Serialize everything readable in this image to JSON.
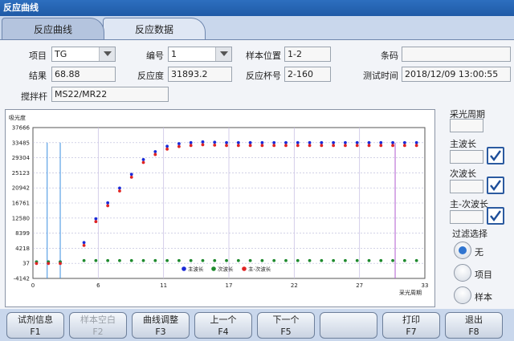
{
  "window": {
    "title": "反应曲线"
  },
  "tabs": [
    {
      "label": "反应曲线",
      "active": true
    },
    {
      "label": "反应数据",
      "active": false
    }
  ],
  "form": {
    "item_label": "项目",
    "item_value": "TG",
    "number_label": "编号",
    "number_value": "1",
    "sample_pos_label": "样本位置",
    "sample_pos_value": "1-2",
    "barcode_label": "条码",
    "barcode_value": "",
    "result_label": "结果",
    "result_value": "68.88",
    "absorbance_label": "反应度",
    "absorbance_value": "31893.2",
    "cup_label": "反应杯号",
    "cup_value": "2-160",
    "test_time_label": "测试时间",
    "test_time_value": "2018/12/09 13:00:55",
    "stirrer_label": "搅拌杆",
    "stirrer_value": "MS22/MR22"
  },
  "chart_data": {
    "type": "scatter",
    "ylabel": "吸光度",
    "xlabel": "采光周期",
    "xlim": [
      0,
      33
    ],
    "ylim": [
      -4142,
      37666
    ],
    "y_ticks": [
      "37666",
      "33485",
      "29304",
      "25123",
      "20942",
      "16761",
      "12580",
      "8399",
      "4218",
      "37",
      "-4142"
    ],
    "x_ticks": [
      "0",
      "6",
      "11",
      "17",
      "22",
      "27",
      "33"
    ],
    "x_tick_values": [
      0,
      5.5,
      11,
      16.5,
      22,
      27.5,
      33
    ],
    "vlines": [
      {
        "x": 1.2,
        "color": "#3b8fe0"
      },
      {
        "x": 2.3,
        "color": "#3b8fe0"
      },
      {
        "x": 30.5,
        "color": "#b05ad0"
      }
    ],
    "legend": [
      "主波长",
      "次波长",
      "主-次波长"
    ],
    "colors": [
      "#1a2ad8",
      "#1e8a2e",
      "#e02424"
    ],
    "series": [
      {
        "name": "主波长",
        "x": [
          0.3,
          1.3,
          2.3,
          4.3,
          5.3,
          6.3,
          7.3,
          8.3,
          9.3,
          10.3,
          11.3,
          12.3,
          13.3,
          14.3,
          15.3,
          16.3,
          17.3,
          18.3,
          19.3,
          20.3,
          21.3,
          22.3,
          23.3,
          24.3,
          25.3,
          26.3,
          27.3,
          28.3,
          29.3,
          30.3,
          31.3,
          32.3
        ],
        "y": [
          450,
          450,
          450,
          5800,
          12400,
          16800,
          20900,
          24700,
          28800,
          31000,
          32500,
          33200,
          33500,
          33700,
          33600,
          33500,
          33500,
          33500,
          33500,
          33500,
          33500,
          33500,
          33500,
          33500,
          33500,
          33500,
          33500,
          33500,
          33500,
          33500,
          33500,
          33500
        ]
      },
      {
        "name": "次波长",
        "x": [
          0.3,
          1.3,
          2.3,
          4.3,
          5.3,
          6.3,
          7.3,
          8.3,
          9.3,
          10.3,
          11.3,
          12.3,
          13.3,
          14.3,
          15.3,
          16.3,
          17.3,
          18.3,
          19.3,
          20.3,
          21.3,
          22.3,
          23.3,
          24.3,
          25.3,
          26.3,
          27.3,
          28.3,
          29.3,
          30.3,
          31.3,
          32.3
        ],
        "y": [
          450,
          450,
          450,
          800,
          800,
          800,
          800,
          800,
          800,
          800,
          800,
          800,
          800,
          800,
          800,
          800,
          800,
          800,
          800,
          800,
          800,
          800,
          800,
          800,
          800,
          800,
          800,
          800,
          800,
          800,
          800,
          800
        ]
      },
      {
        "name": "主-次波长",
        "x": [
          0.3,
          1.3,
          2.3,
          4.3,
          5.3,
          6.3,
          7.3,
          8.3,
          9.3,
          10.3,
          11.3,
          12.3,
          13.3,
          14.3,
          15.3,
          16.3,
          17.3,
          18.3,
          19.3,
          20.3,
          21.3,
          22.3,
          23.3,
          24.3,
          25.3,
          26.3,
          27.3,
          28.3,
          29.3,
          30.3,
          31.3,
          32.3
        ],
        "y": [
          0,
          0,
          0,
          5000,
          11600,
          16000,
          20100,
          23900,
          28000,
          30200,
          31700,
          32400,
          32700,
          32900,
          32800,
          32700,
          32700,
          32700,
          32700,
          32700,
          32700,
          32700,
          32700,
          32700,
          32700,
          32700,
          32700,
          32700,
          32700,
          32700,
          32700,
          32700
        ]
      }
    ]
  },
  "side": {
    "period_label": "采光周期",
    "main_wl_label": "主波长",
    "sub_wl_label": "次波长",
    "diff_wl_label": "主-次波长",
    "filter_label": "过滤选择",
    "filter_options": [
      "无",
      "项目",
      "样本"
    ],
    "filter_selected": "无"
  },
  "footer": [
    {
      "label": "试剂信息",
      "key": "F1",
      "enabled": true
    },
    {
      "label": "样本空白",
      "key": "F2",
      "enabled": false
    },
    {
      "label": "曲线调整",
      "key": "F3",
      "enabled": true
    },
    {
      "label": "上一个",
      "key": "F4",
      "enabled": true
    },
    {
      "label": "下一个",
      "key": "F5",
      "enabled": true
    },
    {
      "label": "",
      "key": "",
      "enabled": true
    },
    {
      "label": "打印",
      "key": "F7",
      "enabled": true
    },
    {
      "label": "退出",
      "key": "F8",
      "enabled": true
    }
  ]
}
